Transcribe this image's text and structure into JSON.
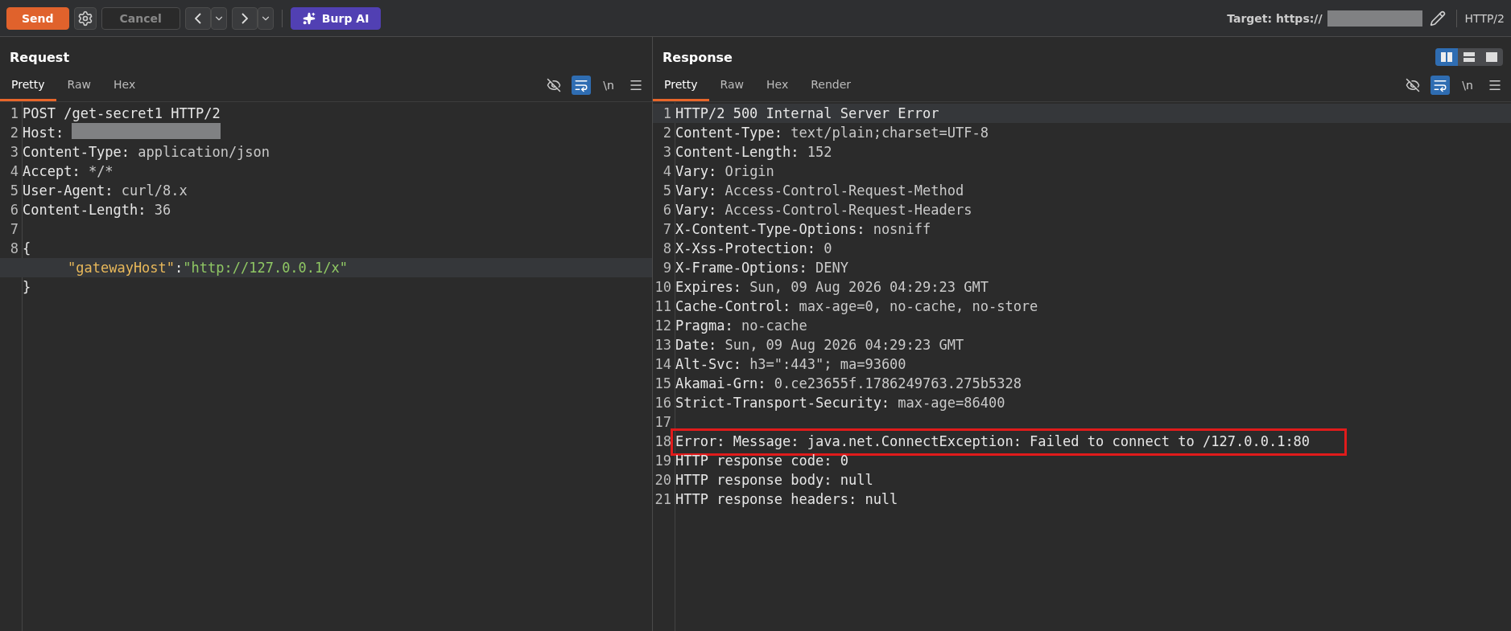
{
  "toolbar": {
    "send": "Send",
    "cancel": {
      "label": "Cancel",
      "disabled": true
    },
    "burp_ai": "Burp AI",
    "target_label": "Target: https://",
    "target_redacted": true,
    "protocol": "HTTP/2"
  },
  "layout_modes": [
    {
      "kind": "split-vertical",
      "selected": true
    },
    {
      "kind": "split-horizontal",
      "selected": false
    },
    {
      "kind": "single",
      "selected": false
    }
  ],
  "request": {
    "title": "Request",
    "tabs": [
      {
        "label": "Pretty",
        "selected": true
      },
      {
        "label": "Raw",
        "selected": false
      },
      {
        "label": "Hex",
        "selected": false
      }
    ],
    "tools": {
      "hide_nonprintable": false,
      "wrap": true,
      "newline": "\\n"
    },
    "rows": [
      {
        "number": "1",
        "kind": "text",
        "text": "POST /get-secret1 HTTP/2"
      },
      {
        "number": "2",
        "kind": "header",
        "name": "Host",
        "sep": ": ",
        "value": "",
        "redacted": true
      },
      {
        "number": "3",
        "kind": "header",
        "name": "Content-Type",
        "sep": ": ",
        "value": "application/json"
      },
      {
        "number": "4",
        "kind": "header",
        "name": "Accept",
        "sep": ": ",
        "value": "*/*"
      },
      {
        "number": "5",
        "kind": "header",
        "name": "User-Agent",
        "sep": ": ",
        "value": "curl/8.x"
      },
      {
        "number": "6",
        "kind": "header",
        "name": "Content-Length",
        "sep": ": ",
        "value": "36"
      },
      {
        "number": "7",
        "kind": "blank"
      },
      {
        "number": "8",
        "kind": "text",
        "text": "{"
      },
      {
        "kind": "json-pair",
        "key": "\"gatewayHost\"",
        "sep": ":",
        "value": "\"http://127.0.0.1/x\"",
        "current": true
      },
      {
        "kind": "text",
        "text": "}"
      }
    ]
  },
  "response": {
    "title": "Response",
    "tabs": [
      {
        "label": "Pretty",
        "selected": true
      },
      {
        "label": "Raw",
        "selected": false
      },
      {
        "label": "Hex",
        "selected": false
      },
      {
        "label": "Render",
        "selected": false
      }
    ],
    "tools": {
      "hide_nonprintable": false,
      "wrap": true,
      "newline": "\\n"
    },
    "rows": [
      {
        "number": "1",
        "kind": "text",
        "text": "HTTP/2 500 Internal Server Error",
        "current": true
      },
      {
        "number": "2",
        "kind": "header",
        "name": "Content-Type",
        "sep": ": ",
        "value": "text/plain;charset=UTF-8"
      },
      {
        "number": "3",
        "kind": "header",
        "name": "Content-Length",
        "sep": ": ",
        "value": "152"
      },
      {
        "number": "4",
        "kind": "header",
        "name": "Vary",
        "sep": ": ",
        "value": "Origin"
      },
      {
        "number": "5",
        "kind": "header",
        "name": "Vary",
        "sep": ": ",
        "value": "Access-Control-Request-Method"
      },
      {
        "number": "6",
        "kind": "header",
        "name": "Vary",
        "sep": ": ",
        "value": "Access-Control-Request-Headers"
      },
      {
        "number": "7",
        "kind": "header",
        "name": "X-Content-Type-Options",
        "sep": ": ",
        "value": "nosniff"
      },
      {
        "number": "8",
        "kind": "header",
        "name": "X-Xss-Protection",
        "sep": ": ",
        "value": "0"
      },
      {
        "number": "9",
        "kind": "header",
        "name": "X-Frame-Options",
        "sep": ": ",
        "value": "DENY"
      },
      {
        "number": "10",
        "kind": "header",
        "name": "Expires",
        "sep": ": ",
        "value": "Sun, 09 Aug 2026 04:29:23 GMT"
      },
      {
        "number": "11",
        "kind": "header",
        "name": "Cache-Control",
        "sep": ": ",
        "value": "max-age=0, no-cache, no-store"
      },
      {
        "number": "12",
        "kind": "header",
        "name": "Pragma",
        "sep": ": ",
        "value": "no-cache"
      },
      {
        "number": "13",
        "kind": "header",
        "name": "Date",
        "sep": ": ",
        "value": "Sun, 09 Aug 2026 04:29:23 GMT"
      },
      {
        "number": "14",
        "kind": "header",
        "name": "Alt-Svc",
        "sep": ": ",
        "value": "h3=\":443\"; ma=93600"
      },
      {
        "number": "15",
        "kind": "header",
        "name": "Akamai-Grn",
        "sep": ": ",
        "value": "0.ce23655f.1786249763.275b5328"
      },
      {
        "number": "16",
        "kind": "header",
        "name": "Strict-Transport-Security",
        "sep": ": ",
        "value": "max-age=86400"
      },
      {
        "number": "17",
        "kind": "blank"
      },
      {
        "number": "18",
        "kind": "text",
        "text": "Error: Message: java.net.ConnectException: Failed to connect to /127.0.0.1:80",
        "boxed": true
      },
      {
        "number": "19",
        "kind": "text",
        "text": "HTTP response code: 0"
      },
      {
        "number": "20",
        "kind": "text",
        "text": "HTTP response body: null"
      },
      {
        "number": "21",
        "kind": "text",
        "text": "HTTP response headers: null"
      }
    ]
  }
}
